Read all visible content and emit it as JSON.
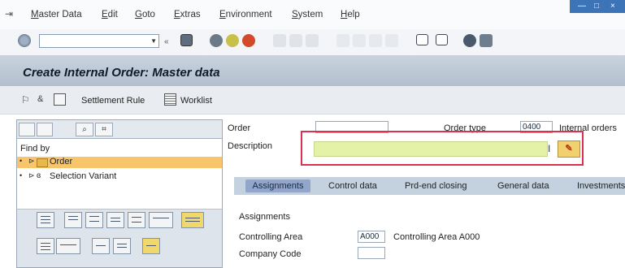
{
  "menubar": {
    "items": [
      "Master Data",
      "Edit",
      "Goto",
      "Extras",
      "Environment",
      "System",
      "Help"
    ]
  },
  "title": "Create Internal Order: Master data",
  "app_toolbar": {
    "settlement_rule": "Settlement Rule",
    "worklist": "Worklist"
  },
  "left_pane": {
    "find_by": "Find by",
    "nodes": [
      "Order",
      "Selection Variant"
    ]
  },
  "header_fields": {
    "order_label": "Order",
    "order_type_label": "Order type",
    "order_type_value": "0400",
    "order_type_text": "Internal orders",
    "description_label": "Description",
    "description_value": ""
  },
  "tabs": [
    "Assignments",
    "Control data",
    "Prd-end closing",
    "General data",
    "Investments"
  ],
  "assignments": {
    "section_title": "Assignments",
    "controlling_area_label": "Controlling Area",
    "controlling_area_value": "A000",
    "controlling_area_text": "Controlling Area A000",
    "company_code_label": "Company Code",
    "company_code_value": ""
  },
  "colors": {
    "title_bar": "#b3bfcd",
    "highlight_border": "#d9324f",
    "description_fill": "#e4f2a8",
    "selected_node": "#f8c56a",
    "active_tab": "#92a6cb"
  }
}
